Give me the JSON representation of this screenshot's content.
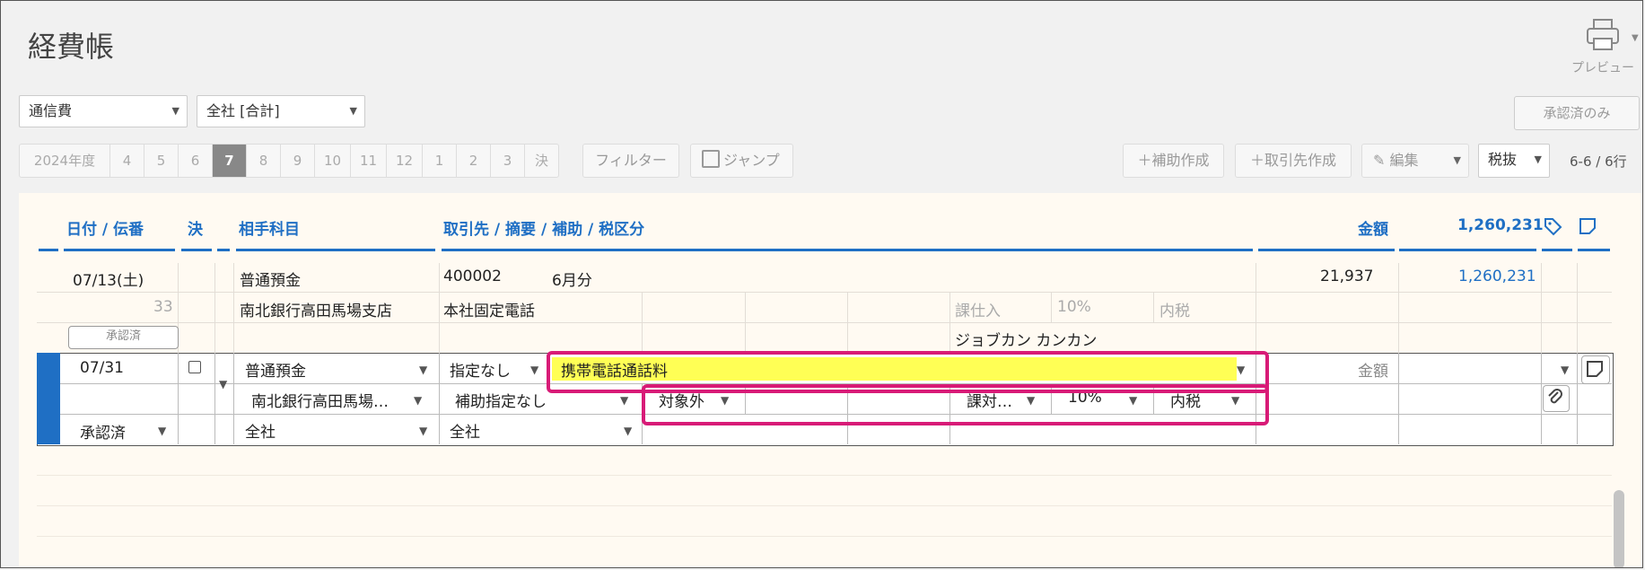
{
  "header": {
    "title": "経費帳",
    "preview_label": "プレビュー"
  },
  "filters": {
    "account": "通信費",
    "department": "全社 [合計]",
    "approved_only": "承認済のみ"
  },
  "toolbar": {
    "fiscal_year": "2024年度",
    "months": [
      "4",
      "5",
      "6",
      "7",
      "8",
      "9",
      "10",
      "11",
      "12",
      "1",
      "2",
      "3",
      "決"
    ],
    "selected_month": "7",
    "filter_label": "フィルター",
    "jump_label": "ジャンプ",
    "add_sub_label": "補助作成",
    "add_partner_label": "取引先作成",
    "edit_label": "編集",
    "tax_mode": "税抜",
    "row_count": "6-6 / 6行"
  },
  "columns": {
    "date": "日付 / 伝番",
    "settled": "決",
    "counter_account": "相手科目",
    "partner": "取引先 / 摘要 / 補助 / 税区分",
    "amount": "金額",
    "balance": "1,260,231"
  },
  "entry": {
    "date": "07/13(土)",
    "voucher": "33",
    "status": "承認済",
    "counter_account": "普通預金",
    "counter_sub": "南北銀行高田馬場支店",
    "partner_code": "400002",
    "memo": "6月分",
    "partner_name": "本社固定電話",
    "tax_class": "課仕入",
    "tax_rate": "10%",
    "tax_incl": "内税",
    "person": "ジョブカン カンカン",
    "amount": "21,937",
    "balance": "1,260,231"
  },
  "edit": {
    "date": "07/31",
    "status": "承認済",
    "counter_account": "普通預金",
    "counter_sub": "南北銀行高田馬場…",
    "counter_dept": "全社",
    "partner": "指定なし",
    "memo": "携帯電話通話料",
    "sub": "補助指定なし",
    "dept": "全社",
    "tax_scope": "対象外",
    "tax_class": "課対…",
    "tax_rate": "10%",
    "tax_incl": "内税",
    "amount_placeholder": "金額"
  }
}
